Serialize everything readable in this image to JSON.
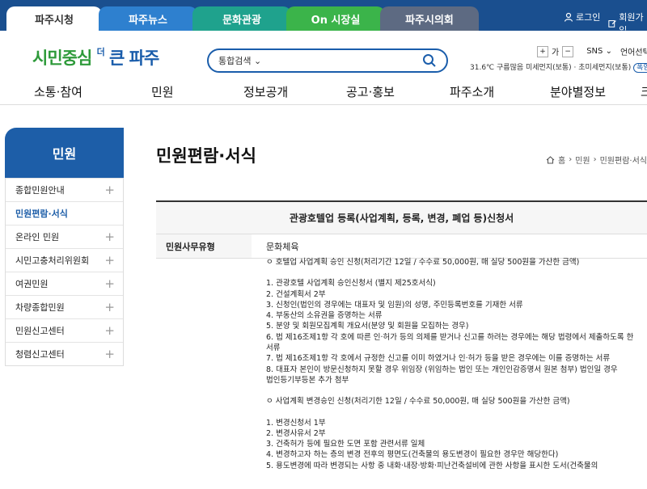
{
  "tabs": [
    "파주시청",
    "파주뉴스",
    "문화관광",
    "On 시장실",
    "파주시의회"
  ],
  "util": {
    "login": "로그인",
    "join": "회원가입"
  },
  "logo": {
    "part1": "시민중심",
    "sup": "더",
    "part2": "큰 파주"
  },
  "search": {
    "category": "통합검색",
    "placeholder": ""
  },
  "font_controls": {
    "plus": "+",
    "label": "가",
    "minus": "−"
  },
  "sns": "SNS",
  "language": "언어선택",
  "weather": {
    "text": "31.6℃ 구름많음 미세먼지(보통) · 초미세먼지(보통)",
    "badge": "폭염경보"
  },
  "nav": [
    "소통·참여",
    "민원",
    "정보공개",
    "공고·홍보",
    "파주소개",
    "분야별정보",
    "크"
  ],
  "sidebar": {
    "title": "민원",
    "items": [
      {
        "label": "종합민원안내",
        "plus": "+"
      },
      {
        "label": "민원편람·서식",
        "plus": ""
      },
      {
        "label": "온라인 민원",
        "plus": "+"
      },
      {
        "label": "시민고충처리위원회",
        "plus": "+"
      },
      {
        "label": "여권민원",
        "plus": "+"
      },
      {
        "label": "차량종합민원",
        "plus": "+"
      },
      {
        "label": "민원신고센터",
        "plus": "+"
      },
      {
        "label": "청렴신고센터",
        "plus": "+"
      }
    ]
  },
  "page_title": "민원편람·서식",
  "breadcrumb": [
    "홈",
    "민원",
    "민원편람·서식"
  ],
  "doc_title": "관광호텔업 등록(사업계획, 등록, 변경, 폐업 등)신청서",
  "type_row": {
    "key": "민원사무유형",
    "value": "문화체육"
  },
  "body_lines": [
    "ㅇ 호텔업 사업계획 승인 신청(처리기간 12일 / 수수료 50,000원, 매 실당 500원을 가산한 금액)",
    "",
    "1. 관광호텔 사업계획 승인신청서 (별지 제25호서식)",
    "2. 건설계획서 2부",
    "3. 신청인(법인의 경우에는 대표자 및 임원)의 성명, 주민등록번호를 기재한 서류",
    "4. 부동산의 소유권을 증명하는 서류",
    "5. 분양 및 회원모집계획 개요서(분양 및 회원을 모집하는 경우)",
    "6. 법 제16조제1항 각 호에 따른 인·허가 등의 의제를 받거나 신고를 하려는 경우에는 해당 법령에서 제출하도록 한",
    "서류",
    "7. 법 제16조제1항 각 호에서 규정한 신고를 이미 하였거나 인·허가 등을 받은 경우에는 이를 증명하는 서류",
    "8. 대표자 본인이 방문신청하지 못할 경우 위임장 (위임하는 법인 또는 개인인감증명서 원본 첨부) 법인일 경우",
    "법인등기부등본 추가 첨부",
    "",
    "ㅇ 사업계획 변경승인 신청(처리기한 12일 / 수수료 50,000원, 매 실당 500원을 가산한 금액)",
    "",
    "1. 변경신청서 1부",
    "2. 변경사유서 2부",
    "3. 건축허가 등에 필요한 도면 포함 관련서류 일체",
    "4. 변경하고자 하는 층의 변경 전후의 평면도(건축물의 용도변경이 필요한 경우만 해당한다)",
    "5. 용도변경에 따라 변경되는 사항 중 내화·내장·방화·피난건축설비에 관한 사항을 표시한 도서(건축물의"
  ]
}
